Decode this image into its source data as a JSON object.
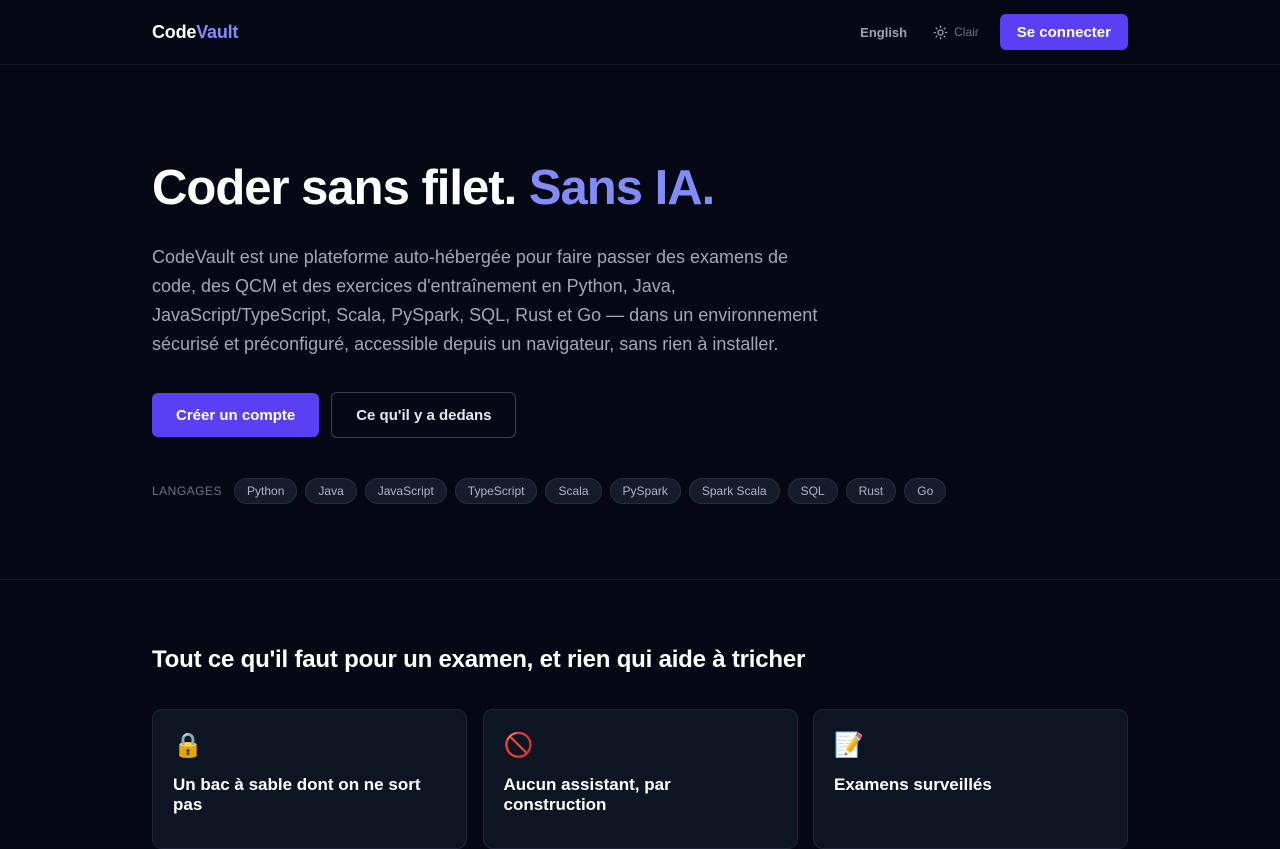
{
  "header": {
    "logo_part1": "Code",
    "logo_part2": "Vault",
    "language_link": "English",
    "theme_toggle": "Clair",
    "login_button": "Se connecter"
  },
  "hero": {
    "title_part1": "Coder sans filet.",
    "title_accent": "Sans IA.",
    "description": "CodeVault est une plateforme auto-hébergée pour faire passer des examens de code, des QCM et des exercices d'entraînement en Python, Java, JavaScript/TypeScript, Scala, PySpark, SQL, Rust et Go — dans un environnement sécurisé et préconfiguré, accessible depuis un navigateur, sans rien à installer.",
    "cta_primary": "Créer un compte",
    "cta_secondary": "Ce qu'il y a dedans",
    "languages_label": "LANGAGES",
    "languages": [
      "Python",
      "Java",
      "JavaScript",
      "TypeScript",
      "Scala",
      "PySpark",
      "Spark Scala",
      "SQL",
      "Rust",
      "Go"
    ]
  },
  "features": {
    "title": "Tout ce qu'il faut pour un examen, et rien qui aide à tricher",
    "cards": [
      {
        "icon": "🔒",
        "icon_name": "lock-icon",
        "title": "Un bac à sable dont on ne sort pas"
      },
      {
        "icon": "🚫",
        "icon_name": "prohibited-icon",
        "title": "Aucun assistant, par construction"
      },
      {
        "icon": "📝",
        "icon_name": "memo-icon",
        "title": "Examens surveillés"
      }
    ]
  },
  "colors": {
    "background": "#050814",
    "accent": "#818cf8",
    "primary_button": "#5b3ff5"
  }
}
